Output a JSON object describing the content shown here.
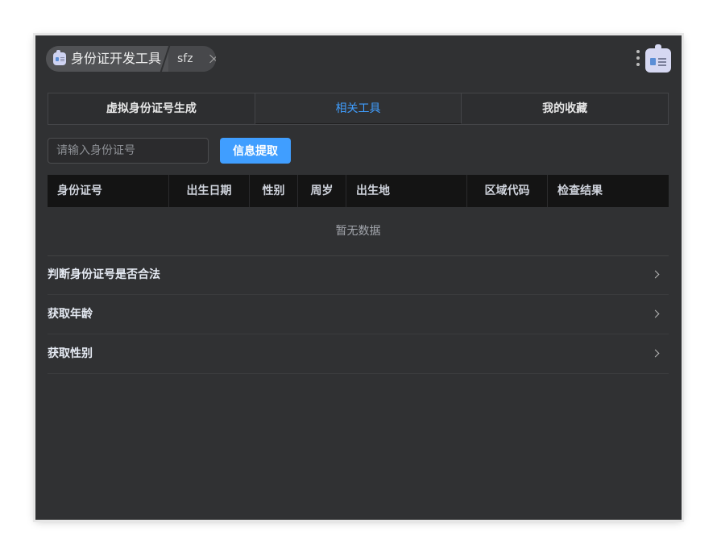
{
  "header": {
    "app_title": "身份证开发工具",
    "tag": "sfz",
    "app_icon": "id-card-icon",
    "menu_icon": "more-vertical-icon",
    "assistant_icon": "robot-icon"
  },
  "tabs": [
    {
      "label": "虚拟身份证号生成",
      "active": false
    },
    {
      "label": "相关工具",
      "active": true
    },
    {
      "label": "我的收藏",
      "active": false
    }
  ],
  "search": {
    "placeholder": "请输入身份证号",
    "value": "",
    "button_label": "信息提取"
  },
  "table": {
    "columns": [
      "身份证号",
      "出生日期",
      "性别",
      "周岁",
      "出生地",
      "区域代码",
      "检查结果"
    ],
    "empty_text": "暂无数据"
  },
  "list": {
    "items": [
      {
        "label": "判断身份证号是否合法"
      },
      {
        "label": "获取年龄"
      },
      {
        "label": "获取性别"
      }
    ]
  },
  "colors": {
    "accent": "#409eff",
    "background": "#303133",
    "header_row": "#141414"
  }
}
